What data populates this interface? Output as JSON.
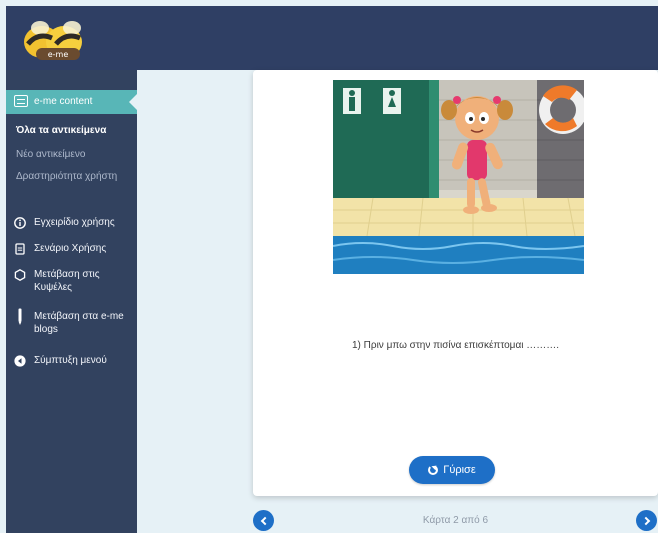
{
  "header": {
    "logo_text": "e-me"
  },
  "sidebar": {
    "section_label": "e-me content",
    "subitems": [
      {
        "label": "Όλα τα αντικείμενα",
        "active": true
      },
      {
        "label": "Νέο αντικείμενο",
        "active": false
      },
      {
        "label": "Δραστηριότητα χρήστη",
        "active": false
      }
    ],
    "items": [
      {
        "label": "Εγχειρίδιο χρήσης",
        "icon": "info-icon"
      },
      {
        "label": "Σενάριο Χρήσης",
        "icon": "document-icon"
      },
      {
        "label": "Μετάβαση στις Κυψέλες",
        "icon": "hexagon-icon"
      },
      {
        "label": "Μετάβαση στα e-me blogs",
        "icon": "pen-icon"
      },
      {
        "label": "Σύμπτυξη μενού",
        "icon": "collapse-icon"
      }
    ]
  },
  "card": {
    "question": "1) Πριν μπω στην πισίνα επισκέπτομαι ……….",
    "flip_label": "Γύρισε"
  },
  "pager": {
    "indicator": "Κάρτα 2 από 6"
  },
  "colors": {
    "topbar": "#2f3f64",
    "sidebar": "#32425f",
    "accent": "#58b6b7",
    "button": "#1e6fc7"
  }
}
